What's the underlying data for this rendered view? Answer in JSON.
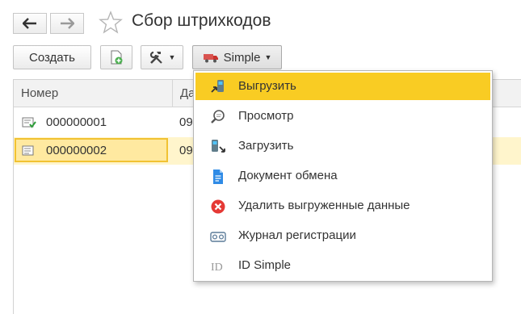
{
  "window": {
    "title": "Сбор штрихкодов"
  },
  "nav": {
    "back_icon": "arrow-left-icon",
    "forward_icon": "arrow-right-icon",
    "favorite_icon": "star-icon"
  },
  "toolbar": {
    "create_label": "Создать",
    "add_copy_icon": "document-add-icon",
    "tools_icon": "wrench-hammer-icon",
    "simple_label": "Simple",
    "simple_icon": "truck-icon"
  },
  "table": {
    "columns": [
      "Номер",
      "Да"
    ],
    "rows": [
      {
        "number": "000000001",
        "date": "09",
        "status_icon": "document-check-icon",
        "selected": false
      },
      {
        "number": "000000002",
        "date": "09",
        "status_icon": "document-icon",
        "selected": true
      }
    ]
  },
  "menu": {
    "items": [
      {
        "label": "Выгрузить",
        "icon": "scanner-upload-icon",
        "highlighted": true
      },
      {
        "label": "Просмотр",
        "icon": "magnifier-icon",
        "highlighted": false
      },
      {
        "label": "Загрузить",
        "icon": "scanner-download-icon",
        "highlighted": false
      },
      {
        "label": "Документ обмена",
        "icon": "document-blue-icon",
        "highlighted": false
      },
      {
        "label": "Удалить выгруженные данные",
        "icon": "delete-red-icon",
        "highlighted": false
      },
      {
        "label": "Журнал регистрации",
        "icon": "log-icon",
        "highlighted": false
      },
      {
        "label": "ID Simple",
        "icon": "id-icon",
        "highlighted": false
      }
    ]
  },
  "colors": {
    "highlight": "#f9cc23",
    "selected_row": "#fff5cc",
    "selected_cell": "#ffe9a0"
  }
}
